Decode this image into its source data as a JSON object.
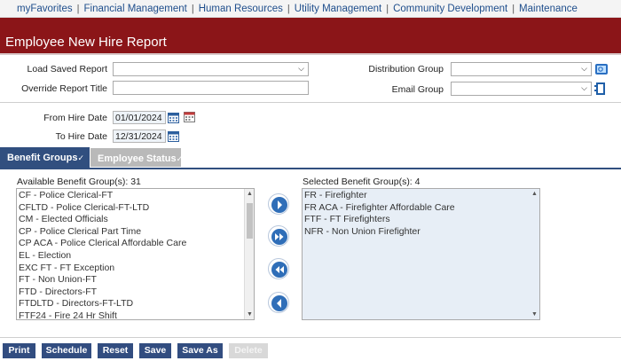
{
  "nav": {
    "items": [
      "myFavorites",
      "Financial Management",
      "Human Resources",
      "Utility Management",
      "Community Development",
      "Maintenance"
    ],
    "separator": "|"
  },
  "page_title": "Employee New Hire Report",
  "form": {
    "load_saved_report_label": "Load Saved Report",
    "override_title_label": "Override Report Title",
    "distribution_group_label": "Distribution Group",
    "email_group_label": "Email Group",
    "from_hire_date_label": "From Hire Date",
    "from_hire_date_value": "01/01/2024",
    "to_hire_date_label": "To Hire Date",
    "to_hire_date_value": "12/31/2024"
  },
  "tabs": {
    "benefit_groups": "Benefit Groups",
    "employee_status": "Employee Status",
    "check": "✓"
  },
  "available": {
    "label": "Available Benefit Group(s): 31",
    "items": [
      "CF - Police Clerical-FT",
      "CFLTD - Police Clerical-FT-LTD",
      "CM - Elected Officials",
      "CP - Police Clerical Part Time",
      "CP ACA - Police Clerical Affordable Care",
      "EL - Election",
      "EXC FT - FT Exception",
      "FT - Non Union-FT",
      "FTD - Directors-FT",
      "FTDLTD - Directors-FT-LTD",
      "FTF24 - Fire 24 Hr Shift"
    ]
  },
  "selected": {
    "label": "Selected Benefit Group(s): 4",
    "items": [
      "FR - Firefighter",
      "FR ACA - Firefighter Affordable Care",
      "FTF - FT Firefighters",
      "NFR - Non Union Firefighter"
    ]
  },
  "buttons": {
    "print": "Print",
    "schedule": "Schedule",
    "reset": "Reset",
    "save": "Save",
    "save_as": "Save As",
    "delete": "Delete"
  },
  "colors": {
    "title_bar": "#8b1518",
    "primary_button": "#324d80",
    "nav_link": "#1f4e8c"
  }
}
